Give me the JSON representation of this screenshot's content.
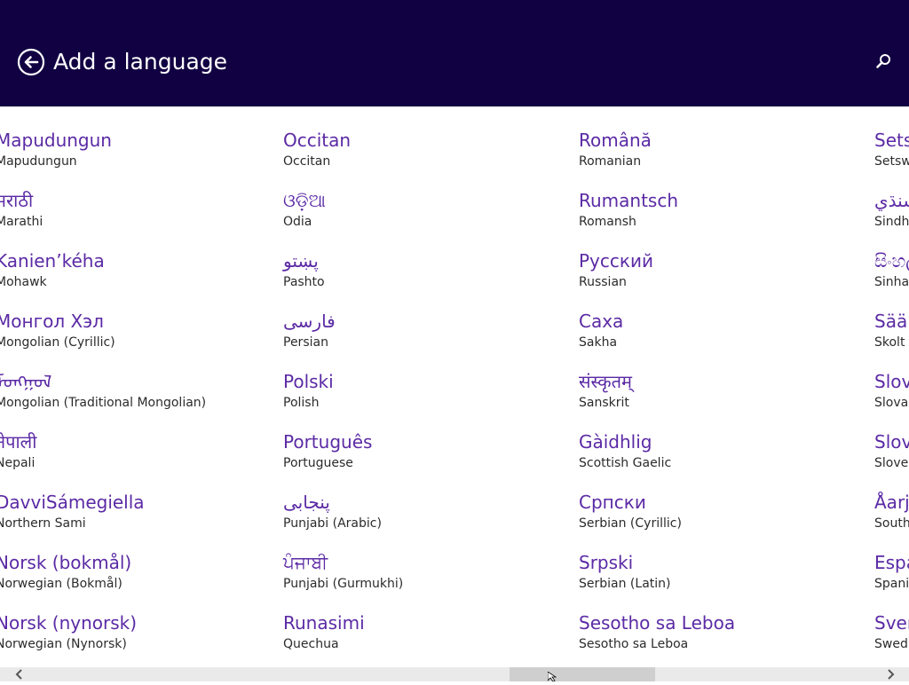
{
  "header": {
    "title": "Add a language",
    "back_icon": "back-arrow-circle-icon",
    "search_icon": "search-icon",
    "background": "#110042"
  },
  "colors": {
    "native_text": "#5b2aa5",
    "english_text": "#2b2b2b"
  },
  "columns": [
    {
      "items": [
        {
          "native": "Mapudungun",
          "english": "Mapudungun"
        },
        {
          "native": "मराठी",
          "english": "Marathi"
        },
        {
          "native": "Kanien’kéha",
          "english": "Mohawk"
        },
        {
          "native": "Монгол Хэл",
          "english": "Mongolian (Cyrillic)"
        },
        {
          "native": "ᠮᠣᠩᠭᠣᠯ",
          "english": "Mongolian (Traditional Mongolian)"
        },
        {
          "native": "नेपाली",
          "english": "Nepali"
        },
        {
          "native": "DavviSámegiella",
          "english": "Northern Sami"
        },
        {
          "native": "Norsk (bokmål)",
          "english": "Norwegian (Bokmål)"
        },
        {
          "native": "Norsk (nynorsk)",
          "english": "Norwegian (Nynorsk)"
        }
      ]
    },
    {
      "items": [
        {
          "native": "Occitan",
          "english": "Occitan"
        },
        {
          "native": "ଓଡ଼ିଆ",
          "english": "Odia"
        },
        {
          "native": "پښتو",
          "english": "Pashto"
        },
        {
          "native": "فارسی",
          "english": "Persian"
        },
        {
          "native": "Polski",
          "english": "Polish"
        },
        {
          "native": "Português",
          "english": "Portuguese"
        },
        {
          "native": "پنجابی",
          "english": "Punjabi (Arabic)"
        },
        {
          "native": "ਪੰਜਾਬੀ",
          "english": "Punjabi (Gurmukhi)"
        },
        {
          "native": "Runasimi",
          "english": "Quechua"
        }
      ]
    },
    {
      "items": [
        {
          "native": "Română",
          "english": "Romanian"
        },
        {
          "native": "Rumantsch",
          "english": "Romansh"
        },
        {
          "native": "Русский",
          "english": "Russian"
        },
        {
          "native": "Саха",
          "english": "Sakha"
        },
        {
          "native": "संस्कृतम्",
          "english": "Sanskrit"
        },
        {
          "native": "Gàidhlig",
          "english": "Scottish Gaelic"
        },
        {
          "native": "Српски",
          "english": "Serbian (Cyrillic)"
        },
        {
          "native": "Srpski",
          "english": "Serbian (Latin)"
        },
        {
          "native": "Sesotho sa Leboa",
          "english": "Sesotho sa Leboa"
        }
      ]
    },
    {
      "items": [
        {
          "native": "Setswana",
          "english": "Setswana"
        },
        {
          "native": "سنڌي",
          "english": "Sindhi"
        },
        {
          "native": "සිංහල",
          "english": "Sinhala"
        },
        {
          "native": "Sääʹmǩiõll",
          "english": "Skolt Sami"
        },
        {
          "native": "Slovenčina",
          "english": "Slovak"
        },
        {
          "native": "Slovenski",
          "english": "Slovenian"
        },
        {
          "native": "Åarjelsaemien",
          "english": "Southern Sami"
        },
        {
          "native": "Español",
          "english": "Spanish"
        },
        {
          "native": "Svenska",
          "english": "Swedish"
        }
      ]
    }
  ],
  "scrollbar": {
    "position": 0.68,
    "left_icon": "chevron-left-icon",
    "right_icon": "chevron-right-icon"
  }
}
